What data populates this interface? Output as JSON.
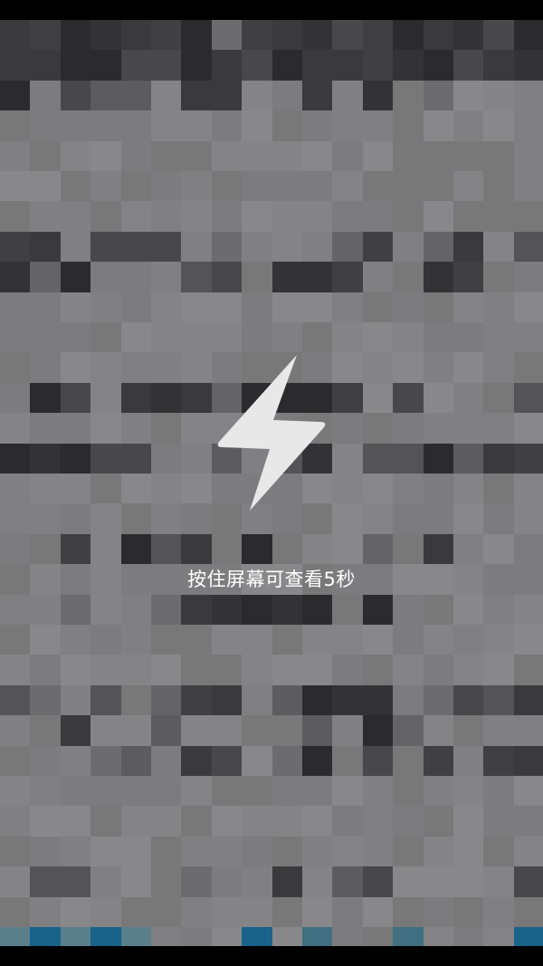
{
  "overlay": {
    "hint": "按住屏幕可查看5秒",
    "icon": "lightning-bolt-icon",
    "icon_color": "#e8e8e8"
  },
  "content": {
    "state": "pixelated",
    "base_color": "#7c7c7e"
  }
}
